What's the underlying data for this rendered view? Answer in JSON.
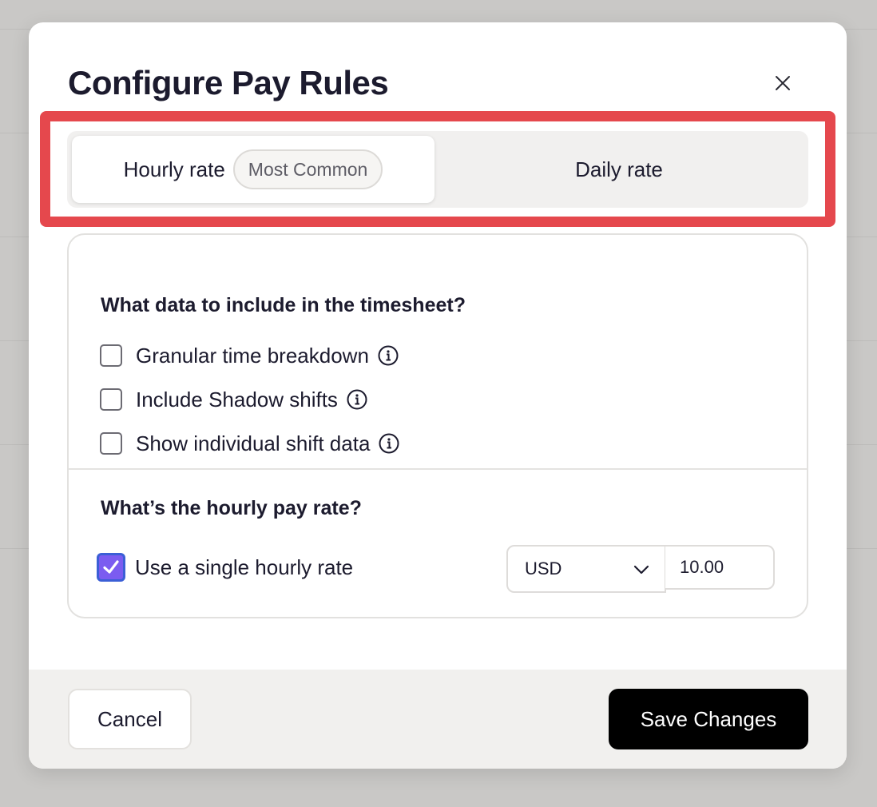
{
  "modal": {
    "title": "Configure Pay Rules"
  },
  "rate_type": {
    "tabs": [
      {
        "label": "Hourly rate",
        "badge": "Most Common",
        "selected": true
      },
      {
        "label": "Daily rate",
        "selected": false
      }
    ]
  },
  "timesheet": {
    "title": "What data to include in the timesheet?",
    "options": [
      {
        "label": "Granular time breakdown",
        "checked": false
      },
      {
        "label": "Include Shadow shifts",
        "checked": false
      },
      {
        "label": "Show individual shift data",
        "checked": false
      }
    ]
  },
  "pay_rate": {
    "title": "What’s the hourly pay rate?",
    "single_rate_label": "Use a single hourly rate",
    "single_rate_checked": true,
    "currency": "USD",
    "amount": "10.00"
  },
  "footer": {
    "cancel_label": "Cancel",
    "save_label": "Save Changes"
  },
  "colors": {
    "highlight": "#e5484d",
    "checkbox_checked": "#7b5cf0",
    "primary_button": "#000000"
  },
  "icons": {
    "close": "close-icon",
    "info": "info-icon",
    "chevron": "chevron-down-icon",
    "check": "check-icon"
  }
}
